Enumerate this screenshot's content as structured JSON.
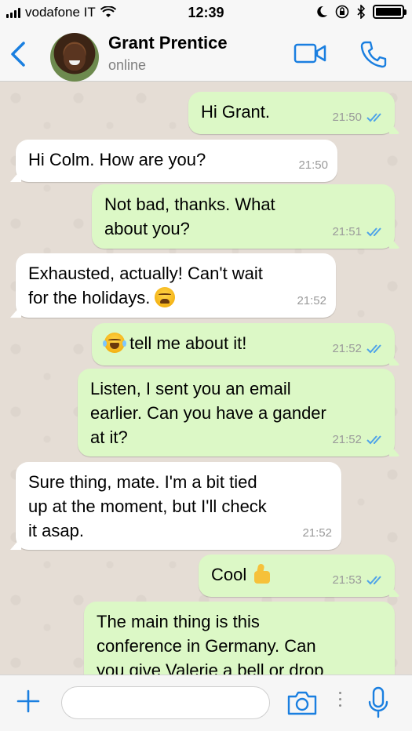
{
  "status_bar": {
    "carrier": "vodafone IT",
    "time": "12:39",
    "battery_level": 1.0
  },
  "header": {
    "contact_name": "Grant Prentice",
    "contact_status": "online",
    "icons": [
      "back-chevron-icon",
      "video-call-icon",
      "phone-icon"
    ]
  },
  "messages": [
    {
      "direction": "out",
      "text": "Hi Grant.",
      "time": "21:50",
      "read": true
    },
    {
      "direction": "in",
      "text": "Hi Colm. How are you?",
      "time": "21:50"
    },
    {
      "direction": "out",
      "text": "Not bad, thanks. What\nabout you?",
      "time": "21:51",
      "read": true
    },
    {
      "direction": "in",
      "text": "Exhausted, actually! Can't wait\nfor the holidays.",
      "emoji": "weary-face",
      "time": "21:52"
    },
    {
      "direction": "out",
      "text": "tell me about it!",
      "emoji": "tears-of-joy",
      "time": "21:52",
      "read": true
    },
    {
      "direction": "out",
      "text": "Listen, I sent you an email\nearlier. Can you have a gander\nat it?",
      "time": "21:52",
      "read": true
    },
    {
      "direction": "in",
      "text": "Sure thing, mate. I'm a bit tied\nup at the moment, but I'll check\nit asap.",
      "time": "21:52"
    },
    {
      "direction": "out",
      "text": "Cool",
      "emoji": "thumbs-up",
      "time": "21:53",
      "read": true
    },
    {
      "direction": "out",
      "text": "The main thing is this\nconference in Germany. Can\nyou give Valerie a bell or drop",
      "time": "",
      "read": false
    }
  ],
  "input_bar": {
    "placeholder": "",
    "icons": [
      "plus-icon",
      "camera-icon",
      "more-dots-icon",
      "microphone-icon"
    ]
  },
  "colors": {
    "accent": "#1a7fe0",
    "outgoing_bubble": "#dcf8c6",
    "incoming_bubble": "#ffffff",
    "chat_background": "#e5ddd5",
    "read_ticks": "#4fa3e8"
  }
}
